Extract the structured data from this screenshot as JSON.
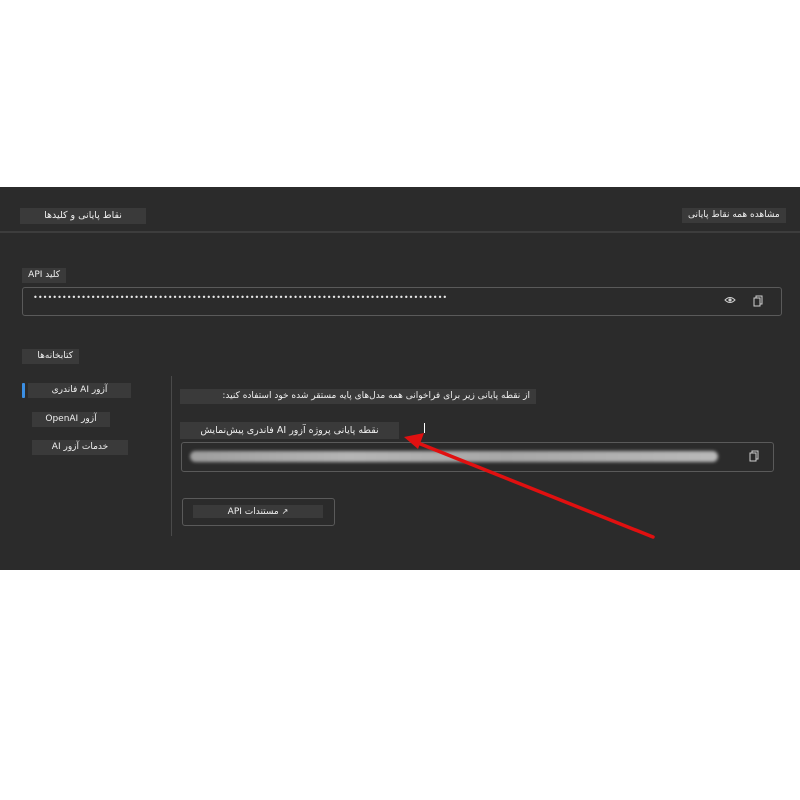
{
  "header": {
    "title": "نقاط پایانی و کلیدها",
    "view_all_link": "مشاهده همه نقاط پایانی"
  },
  "api_key": {
    "label": "کلید API",
    "masked_value": "••••••••••••••••••••••••••••••••••••••••••••••••••••••••••••••••••••••••••••••••••••••"
  },
  "libraries": {
    "label": "کتابخانه‌ها",
    "tabs": [
      {
        "label": "آزور AI فاندری",
        "active": true
      },
      {
        "label": "آزور OpenAI",
        "active": false
      },
      {
        "label": "خدمات آزور AI",
        "active": false
      }
    ]
  },
  "content": {
    "instruction": "از نقطه پایانی زیر برای فراخوانی همه مدل‌های پایه مستقر شده خود استفاده کنید:",
    "endpoint_label": "نقطه پایانی پروژه آزور AI فاندری پیش‌نمایش",
    "docs_button": "مستندات API"
  },
  "icons": {
    "eye": "eye-icon",
    "copy": "copy-icon",
    "external": "external-link-icon"
  },
  "colors": {
    "panel": "#2b2b2b",
    "accent": "#3b8fe4",
    "annotation_arrow": "#e01010"
  }
}
